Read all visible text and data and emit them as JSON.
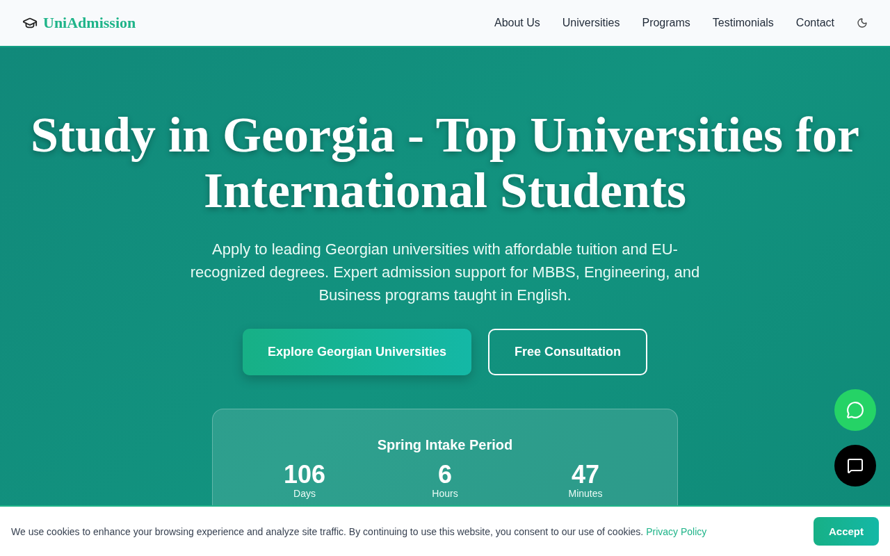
{
  "header": {
    "brand": "UniAdmission",
    "nav": [
      {
        "label": "About Us"
      },
      {
        "label": "Universities"
      },
      {
        "label": "Programs"
      },
      {
        "label": "Testimonials"
      },
      {
        "label": "Contact"
      }
    ]
  },
  "hero": {
    "title": "Study in Georgia - Top Universities for International Students",
    "subtitle": "Apply to leading Georgian universities with affordable tuition and EU-recognized degrees. Expert admission support for MBBS, Engineering, and Business programs taught in English.",
    "buttons": [
      {
        "label": "Explore Georgian Universities",
        "kind": "primary"
      },
      {
        "label": "Free Consultation",
        "kind": "outline"
      }
    ],
    "countdown": {
      "title": "Spring Intake Period",
      "units": [
        {
          "value": "106",
          "label": "Days"
        },
        {
          "value": "6",
          "label": "Hours"
        },
        {
          "value": "47",
          "label": "Minutes"
        }
      ]
    }
  },
  "cookie_banner": {
    "text": "We use cookies to enhance your browsing experience and analyze site traffic. By continuing to use this website, you consent to our use of cookies.",
    "link": "Privacy Policy",
    "button": "Accept"
  }
}
